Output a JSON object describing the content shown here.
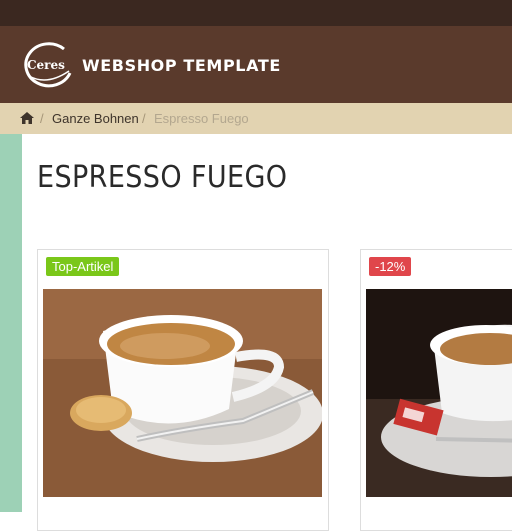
{
  "top_bar": {},
  "header": {
    "logo_text": "Ceres",
    "brand_title": "WEBSHOP TEMPLATE"
  },
  "breadcrumb": {
    "home_icon": "home-icon",
    "separator": "/",
    "items": [
      "Ganze Bohnen",
      "Espresso Fuego"
    ]
  },
  "page": {
    "title": "ESPRESSO FUEGO"
  },
  "products": [
    {
      "badge": "Top-Artikel",
      "badge_color": "#7ac719"
    },
    {
      "badge": "-12%",
      "badge_color": "#e0464b"
    }
  ],
  "colors": {
    "top_bar": "#3b2820",
    "header": "#5a3a2c",
    "breadcrumb_bar": "#e2d3b1",
    "left_strip": "#9dd1b6"
  }
}
